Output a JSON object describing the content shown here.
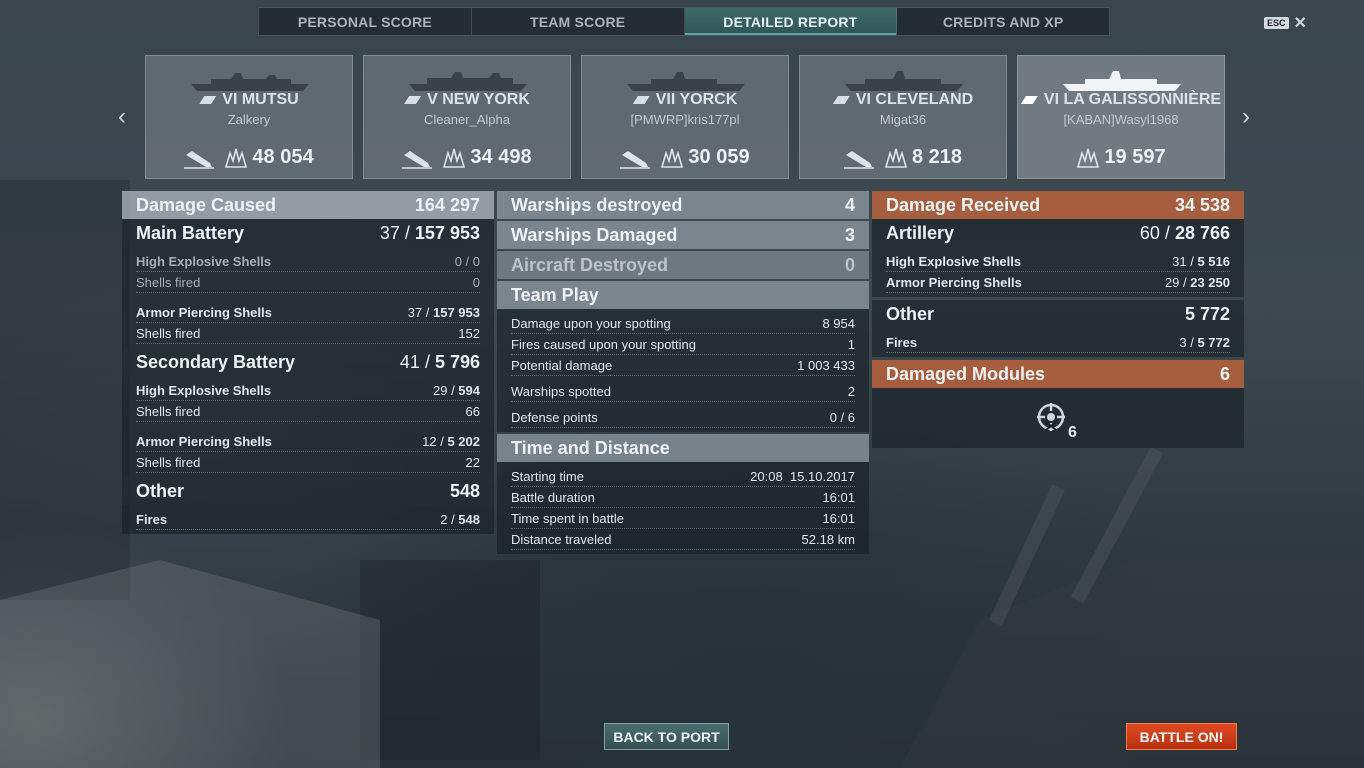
{
  "tabs": [
    "PERSONAL SCORE",
    "TEAM SCORE",
    "DETAILED REPORT",
    "CREDITS AND XP"
  ],
  "active_tab": "DETAILED REPORT",
  "esc_label": "ESC",
  "close_glyph": "✕",
  "nav": {
    "prev_glyph": "‹",
    "next_glyph": "›"
  },
  "ships": [
    {
      "name": "VI MUTSU",
      "player": "Zalkery",
      "damage": "48 054"
    },
    {
      "name": "V NEW YORK",
      "player": "Cleaner_Alpha",
      "damage": "34 498"
    },
    {
      "name": "VII YORCK",
      "player": "[PMWRP]kris177pl",
      "damage": "30 059"
    },
    {
      "name": "VI CLEVELAND",
      "player": "Migat36",
      "damage": "8 218"
    },
    {
      "name": "VI LA GALISSONNIÈRE",
      "player": "[KABAN]Wasyl1968",
      "damage": "19 597"
    }
  ],
  "left": {
    "damage_caused": {
      "label": "Damage Caused",
      "value": "164 297"
    },
    "main_battery": {
      "label": "Main Battery",
      "hits": "37",
      "value": "157 953"
    },
    "mb_he": {
      "label": "High Explosive Shells",
      "hits": "0",
      "value": "0"
    },
    "mb_he_fired": {
      "label": "Shells fired",
      "value": "0"
    },
    "mb_ap": {
      "label": "Armor Piercing Shells",
      "hits": "37",
      "value": "157 953"
    },
    "mb_ap_fired": {
      "label": "Shells fired",
      "value": "152"
    },
    "secondary": {
      "label": "Secondary Battery",
      "hits": "41",
      "value": "5 796"
    },
    "sb_he": {
      "label": "High Explosive Shells",
      "hits": "29",
      "value": "594"
    },
    "sb_he_fired": {
      "label": "Shells fired",
      "value": "66"
    },
    "sb_ap": {
      "label": "Armor Piercing Shells",
      "hits": "12",
      "value": "5 202"
    },
    "sb_ap_fired": {
      "label": "Shells fired",
      "value": "22"
    },
    "other": {
      "label": "Other",
      "value": "548"
    },
    "fires": {
      "label": "Fires",
      "hits": "2",
      "value": "548"
    }
  },
  "middle": {
    "destroyed": {
      "label": "Warships destroyed",
      "value": "4"
    },
    "damaged": {
      "label": "Warships Damaged",
      "value": "3"
    },
    "aircraft": {
      "label": "Aircraft Destroyed",
      "value": "0"
    },
    "team_play": "Team Play",
    "team_rows": [
      {
        "label": "Damage upon your spotting",
        "value": "8 954"
      },
      {
        "label": "Fires caused upon your spotting",
        "value": "1"
      },
      {
        "label": "Potential damage",
        "value": "1 003 433"
      },
      {
        "label": "Warships spotted",
        "value": "2"
      },
      {
        "label": "Defense points",
        "value": "0 / 6"
      }
    ],
    "time_title": "Time and Distance",
    "time_rows": [
      {
        "label": "Starting time",
        "value": "20:08  15.10.2017"
      },
      {
        "label": "Battle duration",
        "value": "16:01"
      },
      {
        "label": "Time spent in battle",
        "value": "16:01"
      },
      {
        "label": "Distance traveled",
        "value": "52.18 km"
      }
    ]
  },
  "right": {
    "received": {
      "label": "Damage Received",
      "value": "34 538"
    },
    "artillery": {
      "label": "Artillery",
      "hits": "60",
      "value": "28 766"
    },
    "art_he": {
      "label": "High Explosive Shells",
      "hits": "31",
      "value": "5 516"
    },
    "art_ap": {
      "label": "Armor Piercing Shells",
      "hits": "29",
      "value": "23 250"
    },
    "other": {
      "label": "Other",
      "value": "5 772"
    },
    "fires": {
      "label": "Fires",
      "hits": "3",
      "value": "5 772"
    },
    "modules": {
      "label": "Damaged Modules",
      "value": "6"
    },
    "module_count": "6"
  },
  "buttons": {
    "back": "BACK TO PORT",
    "battle": "BATTLE ON!"
  },
  "colors": {
    "accent_tab": "#3f6a6a",
    "received_header": "#b3603c",
    "battle_button": "#d0401b"
  }
}
